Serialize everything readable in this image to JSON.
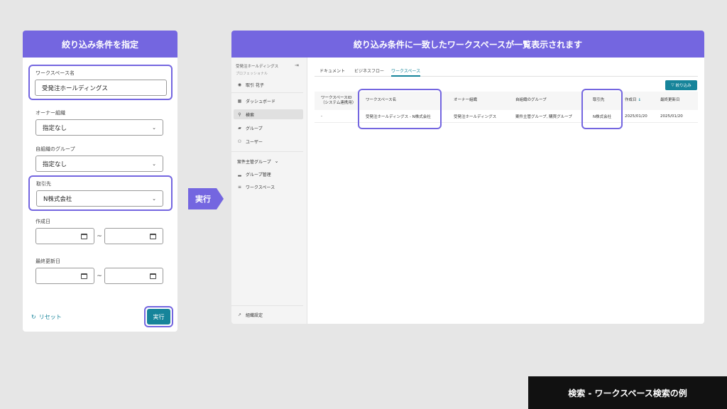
{
  "left_panel": {
    "title": "絞り込み条件を指定",
    "workspace_name": {
      "label": "ワークスペース名",
      "value": "受発注ホールディングス"
    },
    "owner_org": {
      "label": "オーナー組織",
      "value": "指定なし"
    },
    "own_group": {
      "label": "自組織のグループ",
      "value": "指定なし"
    },
    "partner": {
      "label": "取引先",
      "value": "N株式会社"
    },
    "created_date": {
      "label": "作成日",
      "separator": "~"
    },
    "updated_date": {
      "label": "最終更新日",
      "separator": "~"
    },
    "reset_label": "リセット",
    "run_label": "実行"
  },
  "arrow_label": "実行",
  "right_panel": {
    "title": "絞り込み条件に一致したワークスペースが一覧表示されます",
    "sidebar": {
      "org": "受発注ホールディングス",
      "plan": "プロフェッショナル",
      "user": "取引 花子",
      "items": [
        "ダッシュボード",
        "検索",
        "グループ",
        "ユーザー"
      ],
      "section": "案件主管グループ",
      "sub_items": [
        "グループ管理",
        "ワークスペース"
      ],
      "settings": "組織設定"
    },
    "tabs": [
      "ドキュメント",
      "ビジネスフロー",
      "ワークスペース"
    ],
    "active_tab": "ワークスペース",
    "filter_button": "絞り込み",
    "table": {
      "headers": [
        "ワークスペースID\n（システム連携用）",
        "ワークスペース名",
        "オーナー組織",
        "自組織のグループ",
        "取引先",
        "作成日",
        "最終更新日"
      ],
      "row": [
        "-",
        "受発注ホールディングス - N株式会社",
        "受発注ホールディングス",
        "案件主管グループ, 購買グループ",
        "N株式会社",
        "2025/01/20",
        "2025/01/20"
      ]
    }
  },
  "caption": "検索 - ワークスペース検索の例",
  "colors": {
    "accent": "#7466e0",
    "primary": "#16849a",
    "caption_bg": "#111111"
  }
}
